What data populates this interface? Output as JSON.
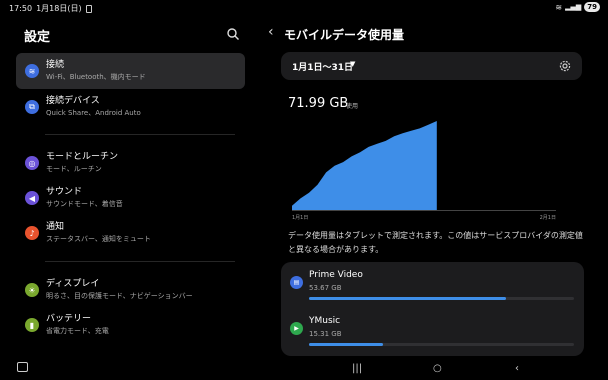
{
  "status": {
    "time": "17:50",
    "date": "1月18日(日)",
    "battery": "79"
  },
  "left": {
    "title": "設定",
    "items": [
      {
        "title": "接続",
        "sub": "Wi-Fi、Bluetooth、機内モード",
        "color": "#3e6ee0",
        "icon": "wifi-icon",
        "glyph": "≋"
      },
      {
        "title": "接続デバイス",
        "sub": "Quick Share、Android Auto",
        "color": "#3e6ee0",
        "icon": "connected-devices-icon",
        "glyph": "⧉"
      },
      {
        "title": "モードとルーチン",
        "sub": "モード、ルーチン",
        "color": "#6b52d8",
        "icon": "modes-icon",
        "glyph": "◎"
      },
      {
        "title": "サウンド",
        "sub": "サウンドモード、着信音",
        "color": "#6b52d8",
        "icon": "sound-icon",
        "glyph": "◀"
      },
      {
        "title": "通知",
        "sub": "ステータスバー、通知をミュート",
        "color": "#e8532e",
        "icon": "bell-icon",
        "glyph": "♪"
      },
      {
        "title": "ディスプレイ",
        "sub": "明るさ、目の保護モード、ナビゲーションバー",
        "color": "#7aa82e",
        "icon": "display-icon",
        "glyph": "☀"
      },
      {
        "title": "バッテリー",
        "sub": "省電力モード、充電",
        "color": "#7aa82e",
        "icon": "battery-icon",
        "glyph": "▮"
      }
    ]
  },
  "right": {
    "title": "モバイルデータ使用量",
    "date_range": "1月1日〜31日",
    "usage_value": "71.99 GB",
    "usage_unit": "使用",
    "note": "データ使用量はタブレットで測定されます。この値はサービスプロバイダの測定値と異なる場合があります。",
    "apps": [
      {
        "name": "Prime Video",
        "size": "53.67 GB",
        "fraction": 0.745,
        "color": "#3e6ee0",
        "icon": "prime-video-icon",
        "glyph": "▤"
      },
      {
        "name": "YMusic",
        "size": "15.31 GB",
        "fraction": 0.28,
        "color": "#2ea84e",
        "icon": "ymusic-icon",
        "glyph": "▶"
      }
    ]
  },
  "chart_data": {
    "type": "area",
    "x": [
      1,
      2,
      3,
      4,
      5,
      6,
      7,
      8,
      9,
      10,
      11,
      12,
      13,
      14,
      15,
      16,
      17,
      18
    ],
    "y": [
      3.5,
      9.4,
      14.0,
      20.4,
      30.4,
      35.7,
      38.7,
      43.3,
      46.7,
      51.0,
      53.6,
      55.9,
      59.7,
      62.0,
      64.0,
      66.0,
      69.0,
      71.99
    ],
    "x_tick_labels": [
      "1月1日",
      "2月1日"
    ],
    "xlim": [
      1,
      32
    ],
    "ylim": [
      0,
      76
    ],
    "xlabel": "",
    "ylabel": "",
    "color": "#3e8ee8",
    "grid": false
  }
}
